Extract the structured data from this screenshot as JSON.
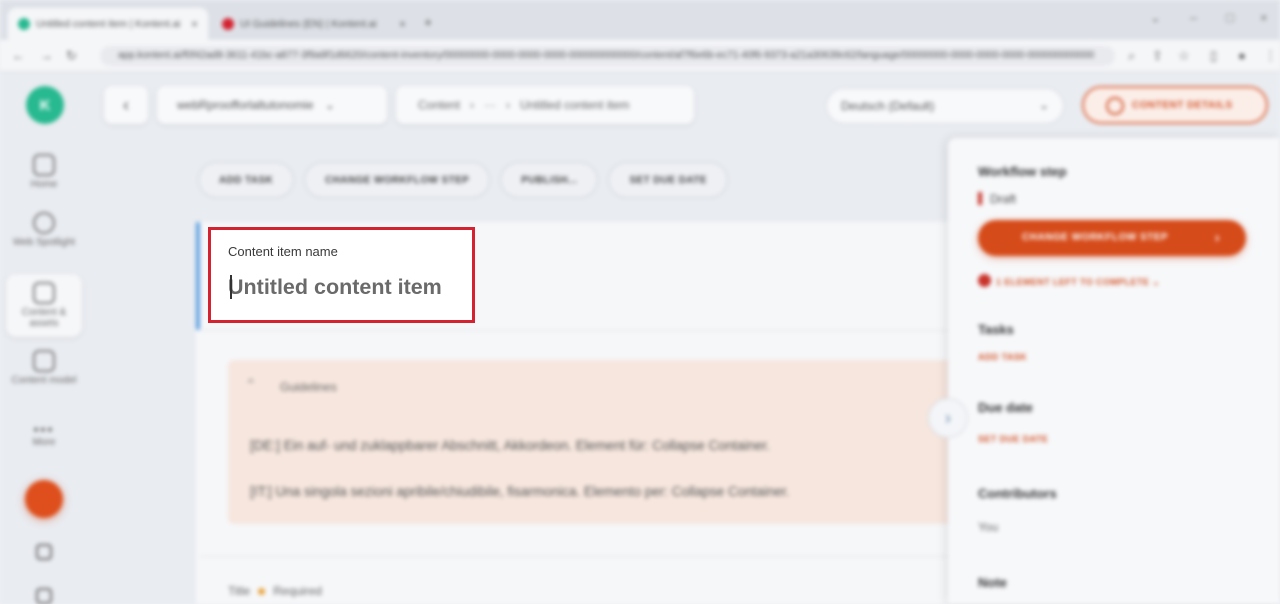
{
  "browser": {
    "tabs": [
      {
        "title": "Untitled content item | Kontent.ai",
        "favicon_color": "#27b990",
        "active": true
      },
      {
        "title": "UI Guidelines (EN) | Kontent.ai",
        "favicon_color": "#d42230",
        "active": false
      }
    ],
    "url": "app.kontent.ai/f0f42ad8-3611-41bc-a877-3f9a9f1d6620/content-inventory/00000000-0000-0000-0000-000000000000/content/af7f6e6b-ec71-40f6-9373-a21a30639c62/language/00000000-0000-0000-0000-000000000000"
  },
  "rail": {
    "logo_text": "K",
    "items": [
      {
        "label": "Home"
      },
      {
        "label": "Web Spotlight"
      },
      {
        "label": "Content & assets"
      },
      {
        "label": "Content model"
      },
      {
        "label": "More"
      }
    ]
  },
  "topbar": {
    "back_label": "‹",
    "project": "webRproofforlaltutonomie",
    "breadcrumbs": [
      "Content",
      "›",
      "···",
      "›",
      "Untitled content item"
    ],
    "language": "Deutsch (Default)",
    "details_button": "CONTENT DETAILS"
  },
  "actions": [
    {
      "label": "ADD TASK"
    },
    {
      "label": "CHANGE WORKFLOW STEP"
    },
    {
      "label": "PUBLISH..."
    },
    {
      "label": "SET DUE DATE"
    }
  ],
  "content_item": {
    "name_label": "Content item name",
    "name_placeholder": "Untitled content item"
  },
  "guidelines": {
    "title": "Guidelines",
    "caret": "^",
    "lines": [
      "[DE:] Ein auf- und zuklappbarer Abschnitt, Akkordeon. Element für: Collapse Container.",
      "[IT:] Una singola sezioni apribile/chiudibile, fisarmonica. Elemento per: Collapse Container."
    ]
  },
  "title_field": {
    "label": "Title",
    "required_label": "Required"
  },
  "sidepanel": {
    "workflow_heading": "Workflow step",
    "workflow_step": "Draft",
    "change_workflow_button": "CHANGE WORKFLOW STEP",
    "elements_left": "1 ELEMENT LEFT TO COMPLETE ⌄",
    "tasks_heading": "Tasks",
    "add_task": "ADD TASK",
    "due_date_heading": "Due date",
    "set_due_date": "SET DUE DATE",
    "contributors_heading": "Contributors",
    "contributor": "You",
    "note_heading": "Note",
    "collapse_icon": "›"
  }
}
